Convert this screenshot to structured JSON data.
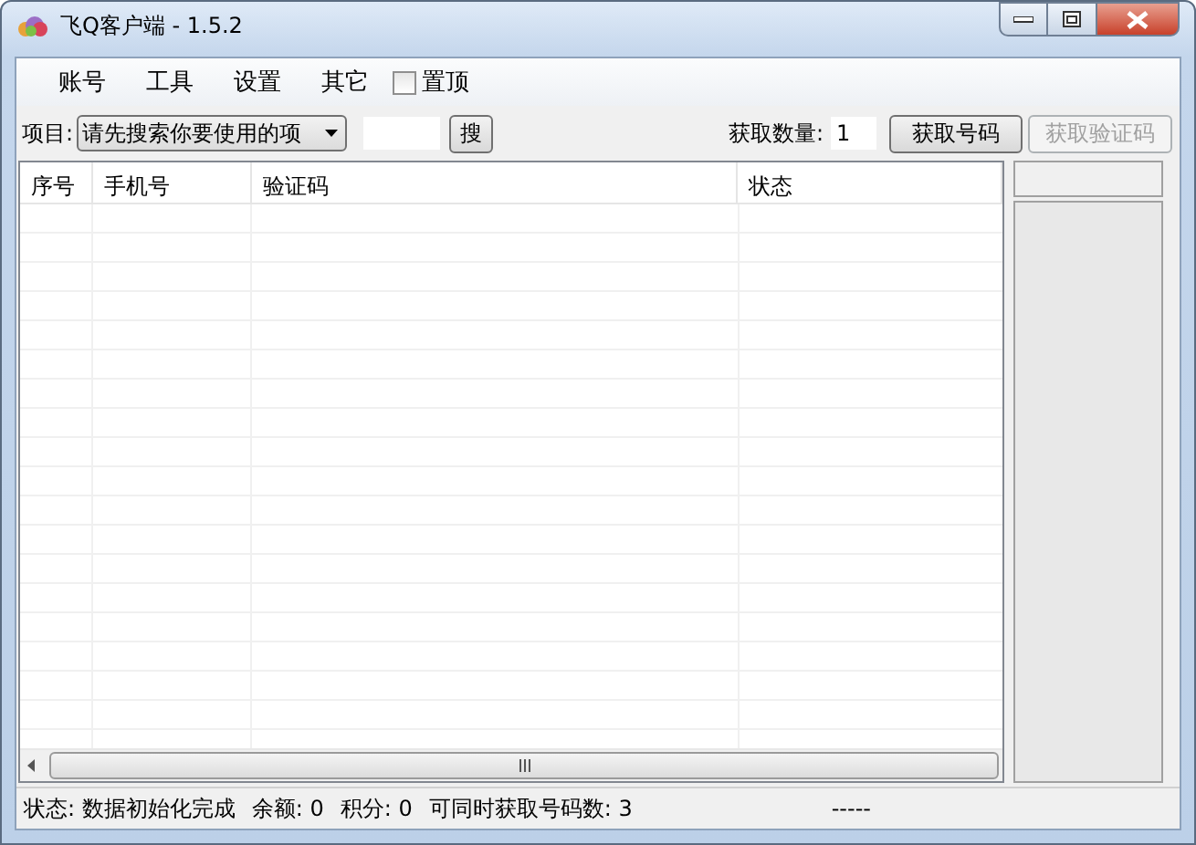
{
  "window": {
    "title": "飞Q客户端 - 1.5.2"
  },
  "menu": [
    {
      "label": "账号"
    },
    {
      "label": "工具"
    },
    {
      "label": "设置"
    },
    {
      "label": "其它"
    }
  ],
  "pin_checkbox": {
    "label": "置顶",
    "checked": false
  },
  "toolbar": {
    "project_label": "项目:",
    "project_select": {
      "value": "请先搜索你要使用的项"
    },
    "search_button": {
      "label": "搜"
    },
    "quantity_label": "获取数量:",
    "quantity_field": {
      "value": "1"
    },
    "buttons": [
      {
        "label": "获取号码",
        "disabled": false
      },
      {
        "label": "获取验证码",
        "disabled": true
      }
    ]
  },
  "table": {
    "columns": [
      "序号",
      "手机号",
      "验证码",
      "状态"
    ]
  },
  "status_bar": {
    "items": [
      "状态: 数据初始化完成",
      "余额: 0",
      "积分: 0",
      "可同时获取号码数: 3"
    ],
    "right": "-----"
  }
}
